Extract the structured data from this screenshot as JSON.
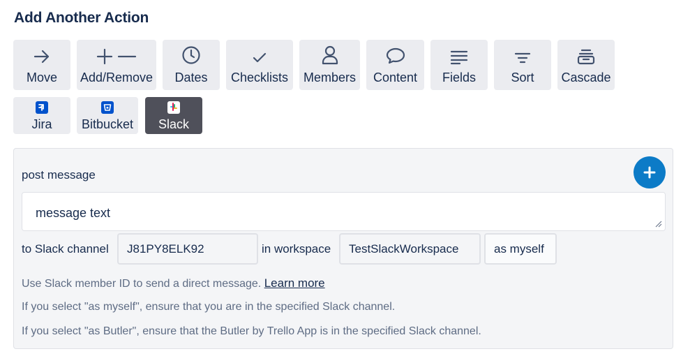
{
  "header": {
    "title": "Add Another Action"
  },
  "actions_row1": [
    {
      "label": "Move",
      "icon": "arrow-right-icon"
    },
    {
      "label": "Add/Remove",
      "icon": "plus-minus-icon"
    },
    {
      "label": "Dates",
      "icon": "clock-icon"
    },
    {
      "label": "Checklists",
      "icon": "checkmark-icon"
    },
    {
      "label": "Members",
      "icon": "person-icon"
    },
    {
      "label": "Content",
      "icon": "speech-bubble-icon"
    },
    {
      "label": "Fields",
      "icon": "lines-icon"
    },
    {
      "label": "Sort",
      "icon": "filter-icon"
    },
    {
      "label": "Cascade",
      "icon": "archive-box-icon"
    }
  ],
  "actions_row2": [
    {
      "label": "Jira",
      "icon": "jira-icon"
    },
    {
      "label": "Bitbucket",
      "icon": "bitbucket-icon"
    },
    {
      "label": "Slack",
      "icon": "slack-icon",
      "selected": true
    }
  ],
  "panel": {
    "label": "post message",
    "message_value": "message text",
    "to_channel_label": "to Slack channel",
    "channel_value": "J81PY8ELK92",
    "in_workspace_label": "in workspace",
    "workspace_value": "TestSlackWorkspace",
    "as_value": "as myself",
    "hint1": "Use Slack member ID to send a direct message.",
    "learn_more": "Learn more",
    "hint2": "If you select \"as myself\", ensure that you are in the specified Slack channel.",
    "hint3": "If you select \"as Butler\", ensure that the Butler by Trello App is in the specified Slack channel."
  },
  "colors": {
    "button_bg": "#ebecf0",
    "selected_bg": "#4f505a",
    "accent": "#0c7bc7",
    "panel_bg": "#f4f5f7"
  }
}
